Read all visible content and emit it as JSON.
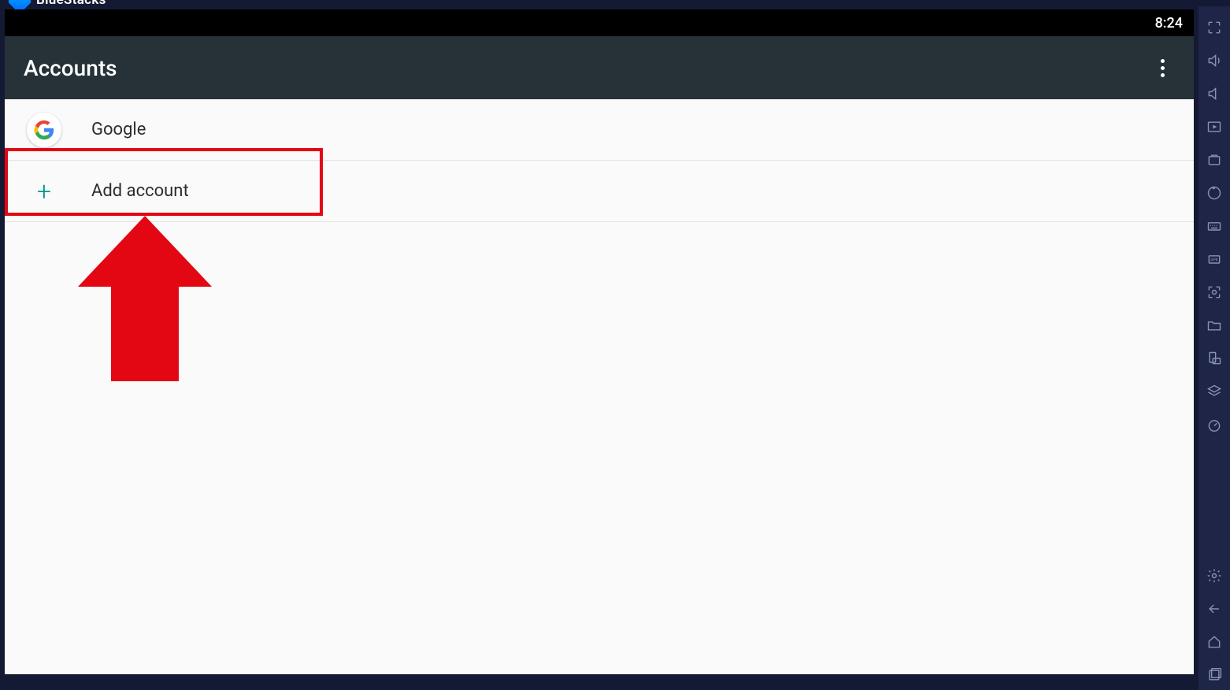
{
  "titlebar": {
    "app_name": "BlueStacks"
  },
  "statusbar": {
    "time": "8:24"
  },
  "appbar": {
    "title": "Accounts"
  },
  "accounts": {
    "items": [
      {
        "label": "Google",
        "icon": "google"
      }
    ],
    "add_label": "Add account"
  },
  "sidebar_icons": [
    "fullscreen",
    "volume-up",
    "volume-down",
    "pip",
    "screenshot-timer",
    "rewind",
    "keyboard",
    "apk",
    "camera2",
    "folder",
    "rotate",
    "layers",
    "speed"
  ],
  "sidebar_bottom_icons": [
    "settings",
    "back-arrow",
    "home",
    "recent-apps"
  ]
}
